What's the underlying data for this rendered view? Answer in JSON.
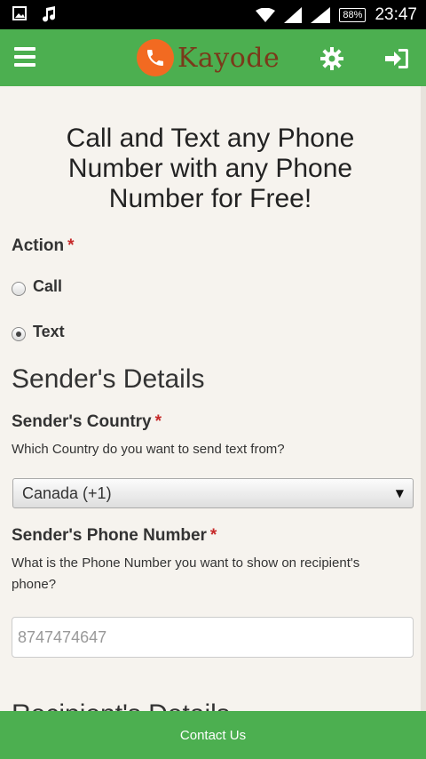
{
  "status_bar": {
    "battery": "88%",
    "time": "23:47",
    "icons": [
      "image-icon",
      "music-note-icon",
      "wifi-icon",
      "signal-icon",
      "signal-icon",
      "battery-icon"
    ]
  },
  "app_bar": {
    "logo_text": "Kayode",
    "menu_icon": "hamburger-menu-icon",
    "settings_icon": "gear-icon",
    "login_icon": "sign-in-icon",
    "brand_color": "#4caf50",
    "logo_color": "#f26a21"
  },
  "hero": {
    "title": "Call and Text any Phone Number with any Phone Number for Free!"
  },
  "action": {
    "label": "Action",
    "required": "*",
    "options": [
      {
        "label": "Call",
        "checked": false
      },
      {
        "label": "Text",
        "checked": true
      }
    ]
  },
  "sender": {
    "section_title": "Sender's Details",
    "country": {
      "label": "Sender's Country",
      "required": "*",
      "hint": "Which Country do you want to send text from?",
      "selected": "Canada (+1)"
    },
    "phone": {
      "label": "Sender's Phone Number",
      "required": "*",
      "hint": "What is the Phone Number you want to show on recipient's phone?",
      "placeholder": "8747474647"
    }
  },
  "next_section_peek": "Recipient's Details",
  "footer": {
    "link": "Contact Us"
  }
}
